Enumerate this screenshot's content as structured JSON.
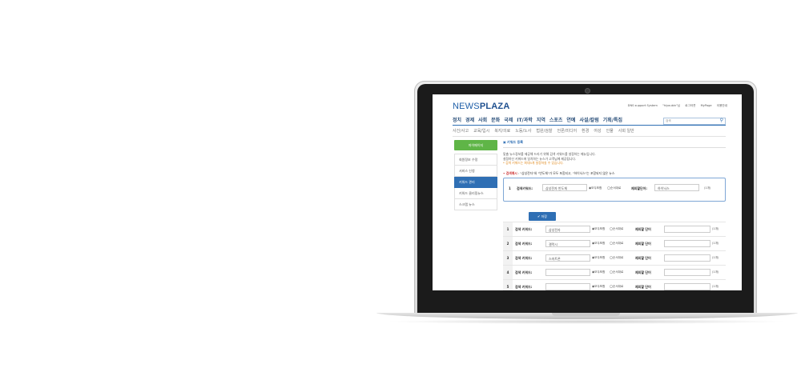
{
  "site": {
    "logo_news": "NEWS",
    "logo_plaza": "PLAZA"
  },
  "toplinks": [
    "DNS support System",
    "\"hiyoubin\"님",
    "로그아웃",
    "MyPage",
    "이용안내"
  ],
  "nav": [
    "정치",
    "경제",
    "사회",
    "문화",
    "국제",
    "IT/과학",
    "지역",
    "스포츠",
    "연예",
    "사설/칼럼",
    "기획/특집"
  ],
  "search": {
    "placeholder": "검색",
    "icon": "search-icon"
  },
  "subnav": [
    "사건/사고",
    "교육/입시",
    "복지/의료",
    "노동/노사",
    "법원/검찰",
    "언론/미디어",
    "환경",
    "여성",
    "인물",
    "사회 일반"
  ],
  "sidebar": {
    "header": "마이페이지",
    "items": [
      "회원정보 수정",
      "서비스 신청",
      "키워드 관리",
      "키워드 클리핑뉴스",
      "스크랩 뉴스"
    ],
    "active_index": 2
  },
  "content": {
    "section_title": "▣ 키워드 등록",
    "intro_line1": "맞춤 뉴스정보를 제공해 드리기 위해 검색 키워드를 설정하는 메뉴입니다.",
    "intro_line2": "설정하신 키워드에 일치하는 뉴스가 고객님께 제공됩니다.",
    "intro_warn": "* 검색 키워드는 최대5개 설정하실 수 있습니다.",
    "example_label_prefix": "• 검색예시",
    "example_label_text": " : \"삼성전자\"와 \"반도체\"가 모두 포함되고, \"하이닉스\"는 포함되지 않은 뉴스",
    "example": {
      "num": "1",
      "label": "검색키워드:",
      "value": "삼성전자 반도체",
      "radio_all": "◉모두포함",
      "radio_order": "◯순서대로",
      "exclude_label": "제외할단어:",
      "exclude_value": "하이닉스",
      "unit": "(1개)"
    },
    "save_label": "✔ 저장"
  },
  "rows": [
    {
      "num": "1",
      "label": "검색 키워드:",
      "value": "삼성전자",
      "radio_all": "◉모두포함",
      "radio_order": "◯순서대로",
      "exclude_label": "제외할 단어",
      "exclude_value": "",
      "unit": "(1개)"
    },
    {
      "num": "2",
      "label": "검색 키워드:",
      "value": "갤럭시",
      "radio_all": "◉모두포함",
      "radio_order": "◯순서대로",
      "exclude_label": "제외할 단어",
      "exclude_value": "",
      "unit": "(1개)"
    },
    {
      "num": "3",
      "label": "검색 키워드:",
      "value": "스마트폰",
      "radio_all": "◉모두포함",
      "radio_order": "◯순서대로",
      "exclude_label": "제외할 단어",
      "exclude_value": "",
      "unit": "(1개)"
    },
    {
      "num": "4",
      "label": "검색 키워드:",
      "value": "",
      "radio_all": "◉모두포함",
      "radio_order": "◯순서대로",
      "exclude_label": "제외할 단어",
      "exclude_value": "",
      "unit": "(1개)"
    },
    {
      "num": "5",
      "label": "검색 키워드:",
      "value": "",
      "radio_all": "◉모두포함",
      "radio_order": "◯순서대로",
      "exclude_label": "제외할 단어",
      "exclude_value": "",
      "unit": "(1개)"
    }
  ]
}
